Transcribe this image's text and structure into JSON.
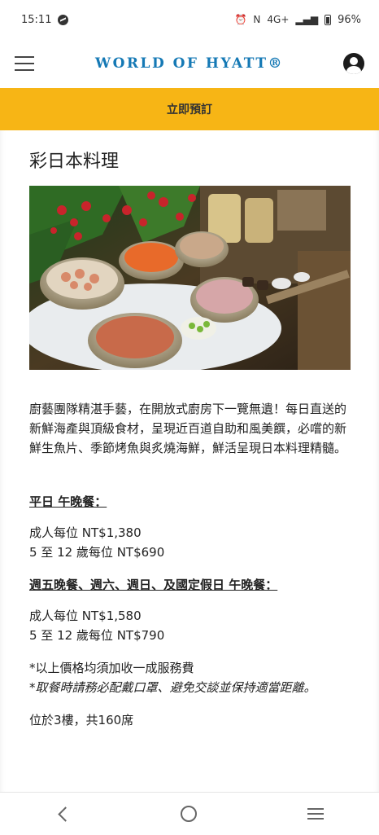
{
  "status_bar": {
    "time": "15:11",
    "network": "4G+",
    "nfc": "N",
    "battery": "96%"
  },
  "header": {
    "logo_text": "WORLD OF HYATT®"
  },
  "booking": {
    "button_label": "立即預訂"
  },
  "page": {
    "title": "彩日本料理",
    "description": "廚藝團隊精湛手藝，在開放式廚房下一覽無遺！每日直送的新鮮海產與頂級食材，呈現近百道自助和風美饌，必嚐的新鮮生魚片、季節烤魚與炙燒海鮮，鮮活呈現日本料理精髓。",
    "weekday_heading": "平日 午晚餐：",
    "weekday_adult": "成人每位 NT$1,380",
    "weekday_child": "5 至 12 歲每位 NT$690",
    "weekend_heading": "週五晚餐、週六、週日、及國定假日 午晚餐：",
    "weekend_adult": "成人每位 NT$1,580",
    "weekend_child": "5 至 12 歲每位 NT$790",
    "note_service": "*以上價格均須加收一成服務費",
    "note_mask": "*取餐時請務必配戴口罩、避免交談並保持適當距離。",
    "seats": "位於3樓，共160席"
  },
  "colors": {
    "brand_blue": "#1579b5",
    "booking_yellow": "#f7b515"
  },
  "icons": {
    "menu": "hamburger-icon",
    "account": "user-avatar-icon",
    "back": "back-icon",
    "home": "home-icon",
    "recents": "recents-icon"
  }
}
